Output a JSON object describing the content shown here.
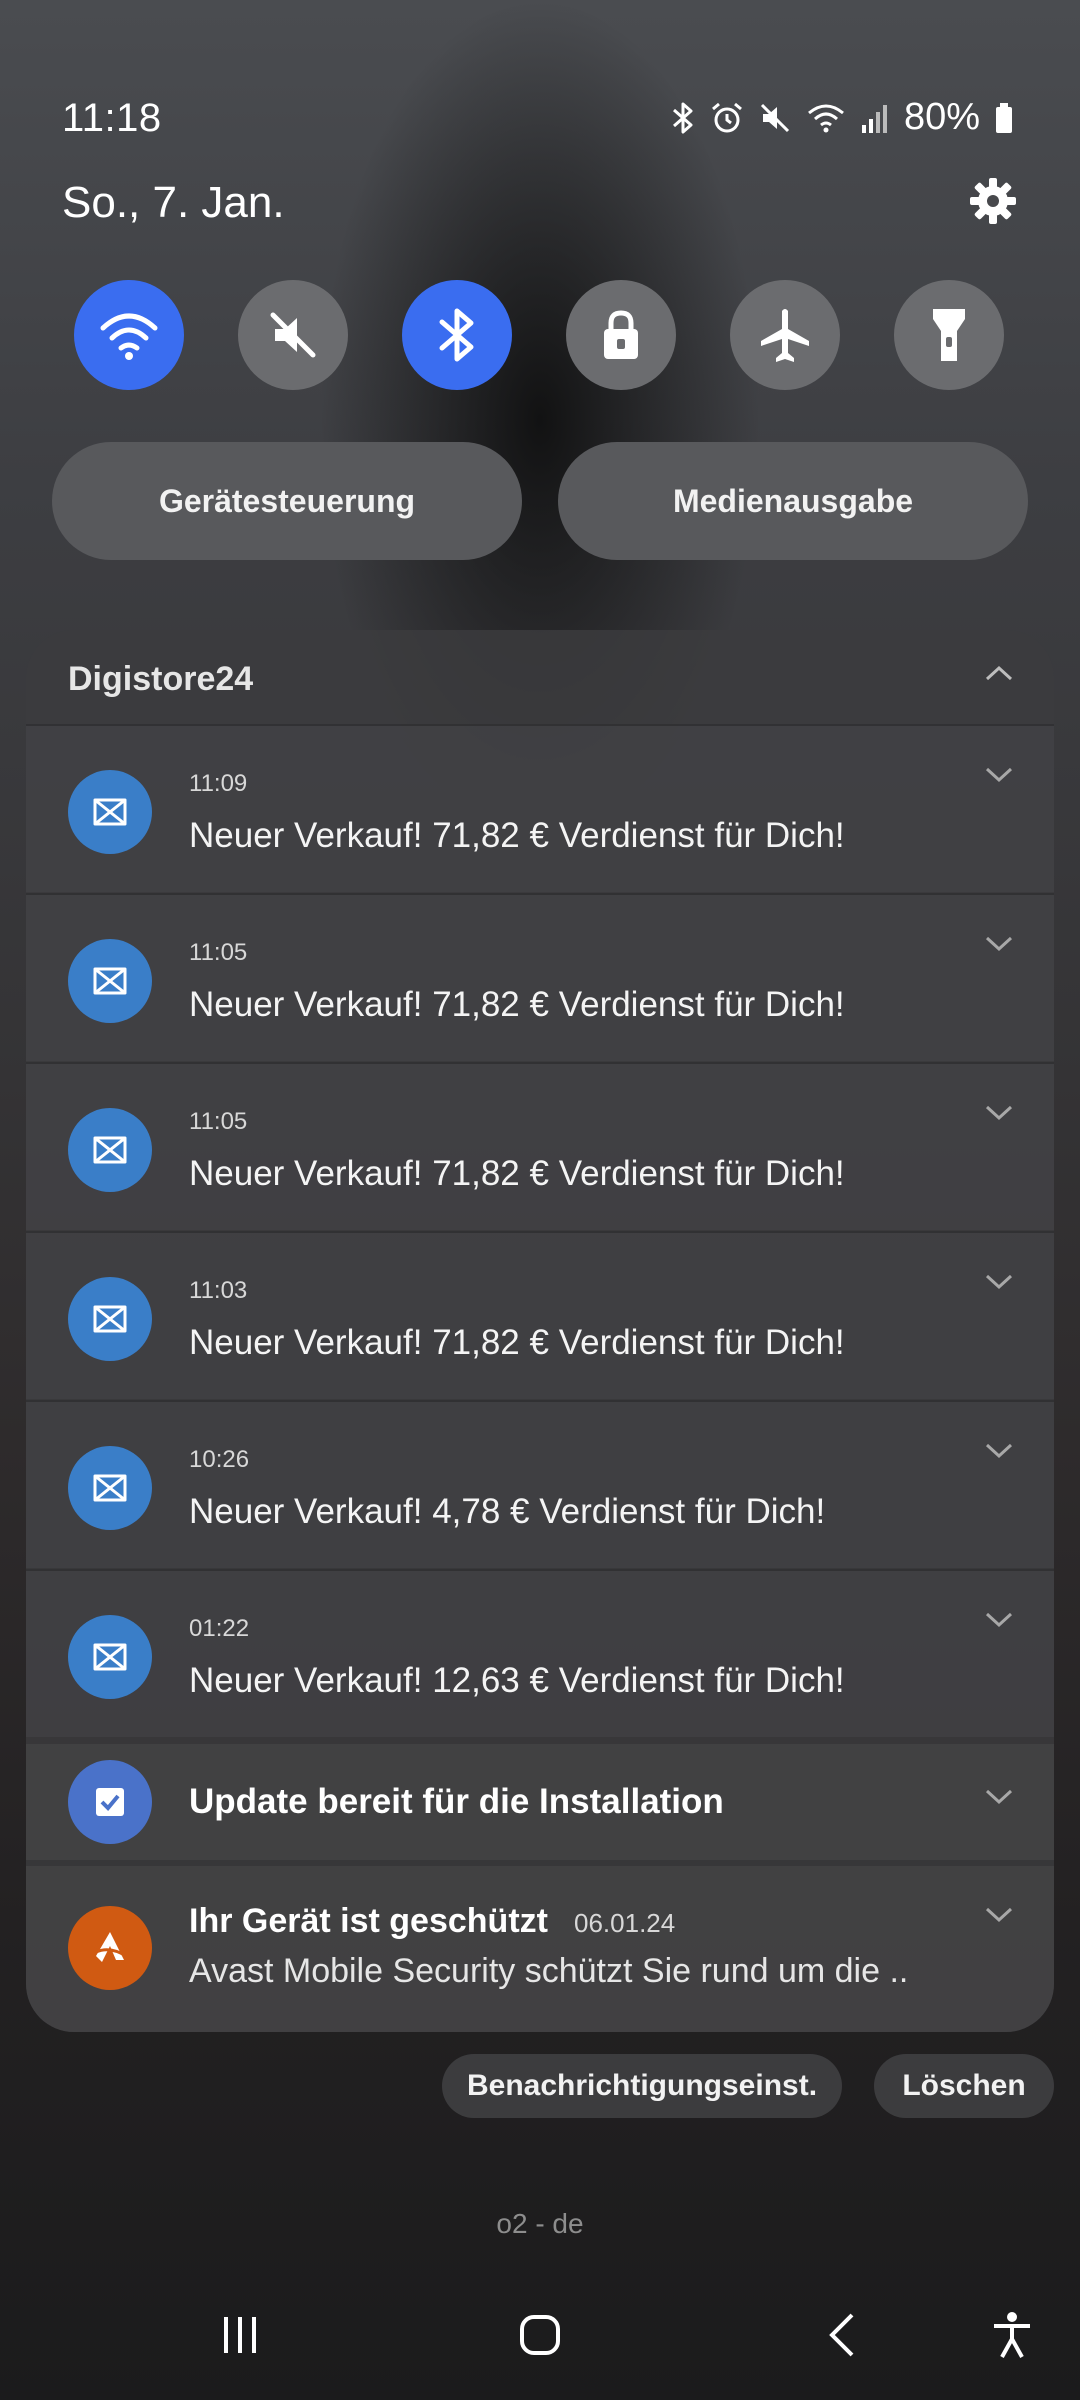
{
  "status_bar": {
    "time": "11:18",
    "battery": "80%",
    "icons": [
      "bluetooth-icon",
      "alarm-icon",
      "mute-icon",
      "wifi-icon",
      "signal-icon",
      "battery-icon"
    ]
  },
  "header": {
    "date": "So., 7. Jan.",
    "settings_icon": "gear-icon"
  },
  "quick_settings": [
    {
      "name": "wifi",
      "icon": "wifi-icon",
      "state": "on"
    },
    {
      "name": "sound",
      "icon": "mute-icon",
      "state": "off"
    },
    {
      "name": "bluetooth",
      "icon": "bluetooth-icon",
      "state": "on"
    },
    {
      "name": "lock",
      "icon": "lock-icon",
      "state": "off"
    },
    {
      "name": "airplane",
      "icon": "airplane-icon",
      "state": "off"
    },
    {
      "name": "flashlight",
      "icon": "flashlight-icon",
      "state": "off"
    }
  ],
  "buttons": {
    "device_control": "Gerätesteuerung",
    "media_output": "Medienausgabe"
  },
  "notification_group": {
    "app": "Digistore24",
    "items": [
      {
        "time": "11:09",
        "text": "Neuer Verkauf! 71,82 € Verdienst für Dich!"
      },
      {
        "time": "11:05",
        "text": "Neuer Verkauf! 71,82 € Verdienst für Dich!"
      },
      {
        "time": "11:05",
        "text": "Neuer Verkauf! 71,82 € Verdienst für Dich!"
      },
      {
        "time": "11:03",
        "text": "Neuer Verkauf! 71,82 € Verdienst für Dich!"
      },
      {
        "time": "10:26",
        "text": "Neuer Verkauf! 4,78 € Verdienst für Dich!"
      },
      {
        "time": "01:22",
        "text": "Neuer Verkauf! 12,63 € Verdienst für Dich!"
      }
    ]
  },
  "update_notification": {
    "title": "Update bereit für die Installation"
  },
  "avast_notification": {
    "title": "Ihr Gerät ist geschützt",
    "date": "06.01.24",
    "body": "Avast Mobile Security schützt Sie rund um die .."
  },
  "footer_buttons": {
    "notification_settings": "Benachrichtigungseinst.",
    "clear": "Löschen"
  },
  "carrier": "o2 - de",
  "colors": {
    "accent": "#3a6df0",
    "digistore": "#3a7ec8",
    "avast": "#d05a12"
  }
}
